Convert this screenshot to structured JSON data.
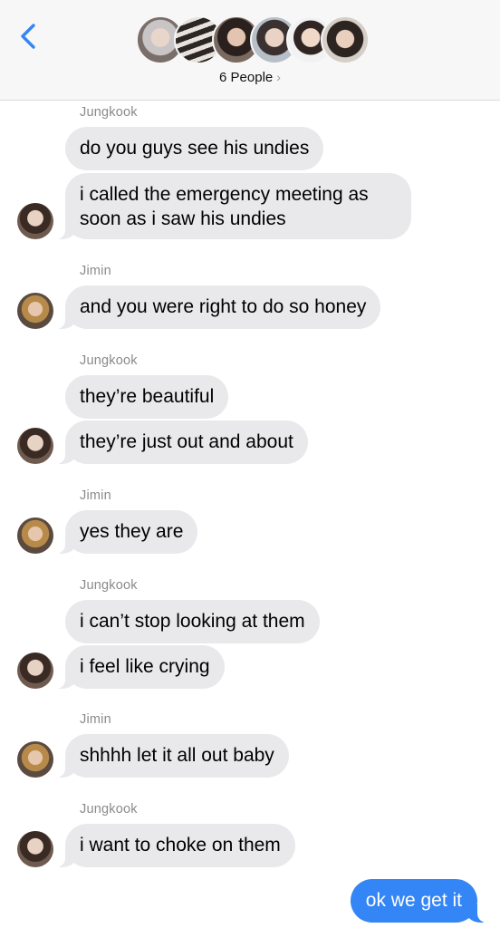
{
  "header": {
    "back_icon": "chevron-left-icon",
    "participants_label": "6 People",
    "participants_chevron": "›",
    "accent_color": "#3485f5"
  },
  "messages": [
    {
      "sender": "Jungkook",
      "text": "do you guys see his undies"
    },
    {
      "sender": "Jungkook",
      "text": "i called the emergency meeting as soon as i saw his undies"
    },
    {
      "sender": "Jimin",
      "text": "and you were right to do so honey"
    },
    {
      "sender": "Jungkook",
      "text": "they’re beautiful"
    },
    {
      "sender": "Jungkook",
      "text": "they’re just out and about"
    },
    {
      "sender": "Jimin",
      "text": "yes they are"
    },
    {
      "sender": "Jungkook",
      "text": "i can’t stop looking at them"
    },
    {
      "sender": "Jungkook",
      "text": "i feel like crying"
    },
    {
      "sender": "Jimin",
      "text": "shhhh let it all out baby"
    },
    {
      "sender": "Jungkook",
      "text": "i want to choke on them"
    }
  ],
  "outgoing": {
    "text": "ok we get it"
  },
  "colors": {
    "incoming_bubble": "#e9e9eb",
    "outgoing_bubble": "#3485f5",
    "sender_name": "#8a8a8e"
  }
}
